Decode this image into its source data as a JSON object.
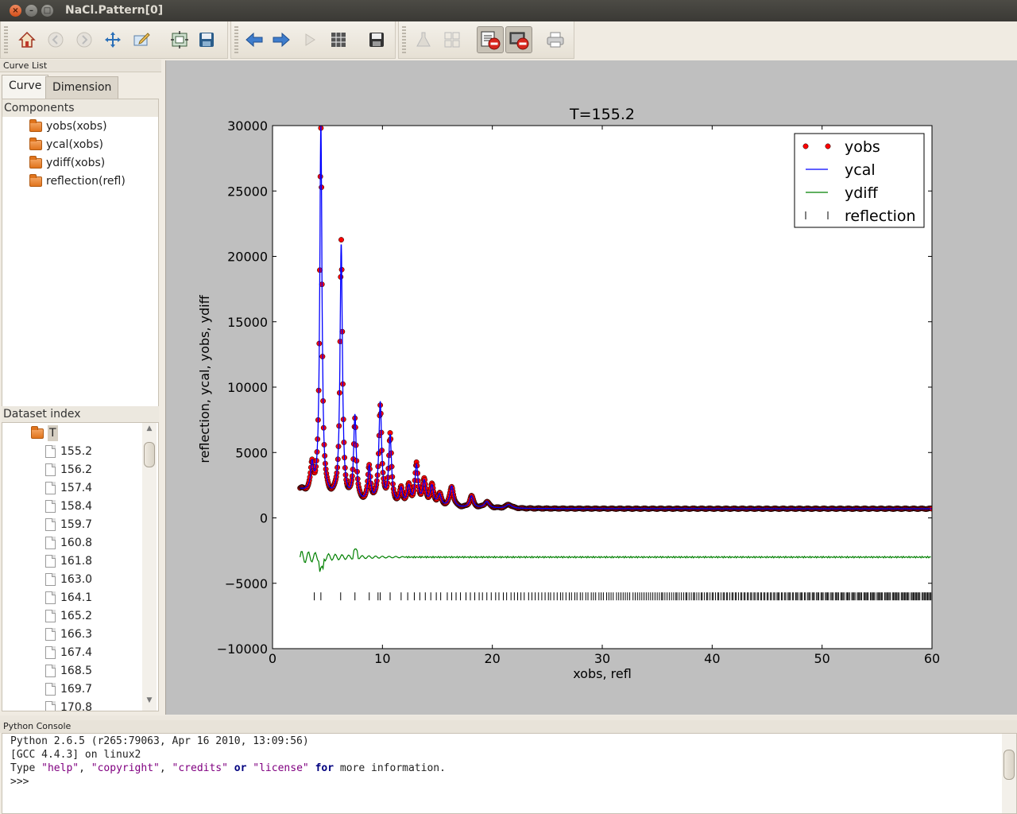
{
  "window": {
    "title": "NaCl.Pattern[0]"
  },
  "toolbar": {
    "icons": [
      "home-icon",
      "back-icon",
      "forward-icon",
      "pan-icon",
      "edit-icon",
      "configure-icon",
      "save-icon",
      "prev-arrow-icon",
      "next-arrow-icon",
      "play-icon",
      "grid-icon",
      "save-figure-icon",
      "flask-icon",
      "layout-icon",
      "remove-curves-icon",
      "remove-plot-icon",
      "print-icon"
    ]
  },
  "left_dock": {
    "title": "Curve List",
    "tabs": [
      "Curve",
      "Dimension"
    ],
    "components_header": "Components",
    "components": [
      "yobs(xobs)",
      "ycal(xobs)",
      "ydiff(xobs)",
      "reflection(refl)"
    ],
    "dataset_header": "Dataset index",
    "dataset_root": "T",
    "dataset_values": [
      "155.2",
      "156.2",
      "157.4",
      "158.4",
      "159.7",
      "160.8",
      "161.8",
      "163.0",
      "164.1",
      "165.2",
      "166.3",
      "167.4",
      "168.5",
      "169.7",
      "170.8"
    ]
  },
  "console": {
    "title": "Python Console",
    "line1": "Python 2.6.5 (r265:79063, Apr 16 2010, 13:09:56)",
    "line2": "[GCC 4.4.3] on linux2",
    "line3_prefix": "Type ",
    "line3_help": "\"help\"",
    "line3_sep1": ", ",
    "line3_copyright": "\"copyright\"",
    "line3_sep2": ", ",
    "line3_credits": "\"credits\"",
    "line3_or": "or",
    "line3_license": "\"license\"",
    "line3_for": "for",
    "line3_rest": " more information.",
    "prompt": ">>>"
  },
  "colors": {
    "yobs": "#ff0000",
    "ycal": "#0000ff",
    "ydiff": "#008000",
    "reflection": "#000000",
    "plot_bg": "#bfbfbf"
  },
  "chart_data": {
    "type": "line",
    "title": "T=155.2",
    "xlabel": "xobs, refl",
    "ylabel": "reflection, ycal, yobs, ydiff",
    "xlim": [
      0,
      60
    ],
    "ylim": [
      -10000,
      30000
    ],
    "xticks": [
      0,
      10,
      20,
      30,
      40,
      50,
      60
    ],
    "yticks": [
      -10000,
      -5000,
      0,
      5000,
      10000,
      15000,
      20000,
      25000,
      30000
    ],
    "legend": {
      "placement": "top-right",
      "entries": [
        "yobs",
        "ycal",
        "ydiff",
        "reflection"
      ]
    },
    "peaks": [
      {
        "x": 3.6,
        "h": 2000,
        "w": 0.15
      },
      {
        "x": 4.4,
        "h": 28500,
        "w": 0.12
      },
      {
        "x": 6.25,
        "h": 19500,
        "w": 0.13
      },
      {
        "x": 7.5,
        "h": 6500,
        "w": 0.14
      },
      {
        "x": 8.8,
        "h": 2700,
        "w": 0.15
      },
      {
        "x": 9.8,
        "h": 7700,
        "w": 0.15
      },
      {
        "x": 10.7,
        "h": 5200,
        "w": 0.15
      },
      {
        "x": 11.7,
        "h": 1200,
        "w": 0.16
      },
      {
        "x": 12.4,
        "h": 1400,
        "w": 0.17
      },
      {
        "x": 13.1,
        "h": 3000,
        "w": 0.17
      },
      {
        "x": 13.8,
        "h": 1800,
        "w": 0.18
      },
      {
        "x": 14.5,
        "h": 1500,
        "w": 0.18
      },
      {
        "x": 15.2,
        "h": 900,
        "w": 0.2
      },
      {
        "x": 16.3,
        "h": 1600,
        "w": 0.2
      },
      {
        "x": 18.1,
        "h": 900,
        "w": 0.2
      },
      {
        "x": 19.5,
        "h": 500,
        "w": 0.25
      },
      {
        "x": 21.5,
        "h": 300,
        "w": 0.3
      }
    ],
    "background": {
      "base": 700,
      "amp": 1400,
      "decay": 4.0,
      "x_start": 2.5
    },
    "ydiff_offset": -3000,
    "reflection_y": -6000,
    "reflections": [
      3.8,
      4.4,
      6.2,
      7.5,
      8.8,
      9.6,
      9.8,
      10.7,
      11.7,
      12.3,
      12.9,
      13.4,
      13.9,
      14.4,
      14.9,
      15.3,
      15.9,
      16.3,
      16.7,
      17.1,
      17.6,
      18.0,
      18.4,
      18.8,
      19.1,
      19.5,
      19.9,
      20.3,
      20.6,
      21.0,
      21.3,
      21.7,
      22.0,
      22.3,
      22.6,
      22.9,
      23.3,
      23.6,
      23.9,
      24.2,
      24.5,
      24.8,
      25.1,
      25.3,
      25.6,
      25.9,
      26.2,
      26.4,
      26.7,
      27.0,
      27.2,
      27.5,
      27.7,
      28.0,
      28.2,
      28.5,
      28.7,
      29.0,
      29.2,
      29.4,
      29.7,
      29.9,
      30.1,
      30.4,
      30.6,
      30.8,
      31.0,
      31.3,
      31.5,
      31.7,
      31.9,
      32.1,
      32.3,
      32.5,
      32.8,
      33.0,
      33.2,
      33.4,
      33.6,
      33.8,
      34.0,
      34.2,
      34.4,
      34.6,
      34.8,
      35.0,
      35.2,
      35.4,
      35.5,
      35.7,
      35.9,
      36.1,
      36.3,
      36.5,
      36.7,
      36.8,
      37.0,
      37.2,
      37.4,
      37.6,
      37.7,
      37.9,
      38.1,
      38.3,
      38.4,
      38.6,
      38.8,
      39.0,
      39.1,
      39.3,
      39.5,
      39.6,
      39.8,
      40.0,
      40.1,
      40.3,
      40.5,
      40.6,
      40.8,
      41.0,
      41.1,
      41.3,
      41.4,
      41.6,
      41.8,
      41.9,
      42.1,
      42.2,
      42.4,
      42.6,
      42.7,
      42.9,
      43.0,
      43.2,
      43.3,
      43.5,
      43.6,
      43.8,
      43.9,
      44.1,
      44.2,
      44.4,
      44.5,
      44.7,
      44.8,
      45.0,
      45.1,
      45.3,
      45.4,
      45.6,
      45.7,
      45.9,
      46.0,
      46.1,
      46.3,
      46.4,
      46.6,
      46.7,
      46.9,
      47.0,
      47.1,
      47.3,
      47.4,
      47.6,
      47.7,
      47.8,
      48.0,
      48.1,
      48.2,
      48.4,
      48.5,
      48.7,
      48.8,
      48.9,
      49.1,
      49.2,
      49.3,
      49.5,
      49.6,
      49.7,
      49.9,
      50.0,
      50.1,
      50.3,
      50.4,
      50.5,
      50.6,
      50.8,
      50.9,
      51.0,
      51.2,
      51.3,
      51.4,
      51.5,
      51.7,
      51.8,
      51.9,
      52.0,
      52.2,
      52.3,
      52.4,
      52.5,
      52.7,
      52.8,
      52.9,
      53.0,
      53.2,
      53.3,
      53.4,
      53.5,
      53.6,
      53.8,
      53.9,
      54.0,
      54.1,
      54.2,
      54.4,
      54.5,
      54.6,
      54.7,
      54.8,
      55.0,
      55.1,
      55.2,
      55.3,
      55.4,
      55.5,
      55.7,
      55.8,
      55.9,
      56.0,
      56.1,
      56.2,
      56.4,
      56.5,
      56.6,
      56.7,
      56.8,
      56.9,
      57.0,
      57.2,
      57.3,
      57.4,
      57.5,
      57.6,
      57.7,
      57.8,
      57.9,
      58.1,
      58.2,
      58.3,
      58.4,
      58.5,
      58.6,
      58.7,
      58.8,
      58.9,
      59.1,
      59.2,
      59.3,
      59.4,
      59.5,
      59.6,
      59.7,
      59.8,
      59.9
    ]
  }
}
